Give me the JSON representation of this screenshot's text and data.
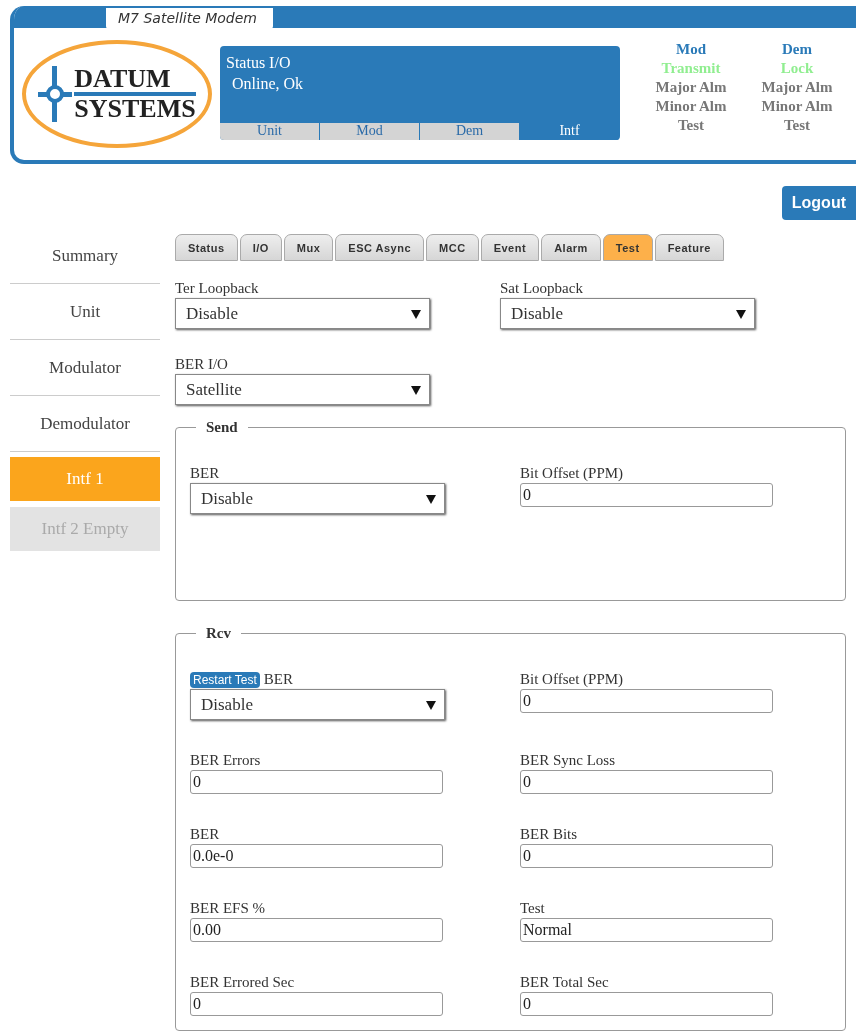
{
  "header": {
    "title": "M7 Satellite Modem",
    "logo": [
      "DATUM",
      "SYSTEMS"
    ],
    "status": {
      "label": "Status I/O",
      "value": "Online, Ok",
      "tabs": [
        {
          "label": "Unit",
          "selected": false
        },
        {
          "label": "Mod",
          "selected": false
        },
        {
          "label": "Dem",
          "selected": false
        },
        {
          "label": "Intf",
          "selected": true
        }
      ]
    },
    "indicators": [
      {
        "title": "Mod",
        "items": [
          {
            "label": "Transmit",
            "on": true
          },
          {
            "label": "Major Alm",
            "on": false
          },
          {
            "label": "Minor Alm",
            "on": false
          },
          {
            "label": "Test",
            "on": false
          }
        ]
      },
      {
        "title": "Dem",
        "items": [
          {
            "label": "Lock",
            "on": true
          },
          {
            "label": "Major Alm",
            "on": false
          },
          {
            "label": "Minor Alm",
            "on": false
          },
          {
            "label": "Test",
            "on": false
          }
        ]
      }
    ]
  },
  "logout": "Logout",
  "sidebar": {
    "items": [
      {
        "label": "Summary",
        "selected": false,
        "disabled": false
      },
      {
        "label": "Unit",
        "selected": false,
        "disabled": false
      },
      {
        "label": "Modulator",
        "selected": false,
        "disabled": false
      },
      {
        "label": "Demodulator",
        "selected": false,
        "disabled": false
      },
      {
        "label": "Intf 1",
        "selected": true,
        "disabled": false
      },
      {
        "label": "Intf 2 Empty",
        "selected": false,
        "disabled": true
      }
    ]
  },
  "tabs": [
    {
      "label": "Status",
      "selected": false
    },
    {
      "label": "I/O",
      "selected": false
    },
    {
      "label": "Mux",
      "selected": false
    },
    {
      "label": "ESC Async",
      "selected": false
    },
    {
      "label": "MCC",
      "selected": false
    },
    {
      "label": "Event",
      "selected": false
    },
    {
      "label": "Alarm",
      "selected": false
    },
    {
      "label": "Test",
      "selected": true
    },
    {
      "label": "Feature",
      "selected": false
    }
  ],
  "fields": [
    {
      "label": "Ter Loopback",
      "kind": "select",
      "value": "Disable"
    },
    {
      "label": "Sat Loopback",
      "kind": "select",
      "value": "Disable"
    },
    {
      "label": "BER I/O",
      "kind": "select",
      "value": "Satellite"
    }
  ],
  "sections": [
    {
      "legend": "Send",
      "fields": [
        {
          "label": "BER",
          "kind": "select",
          "value": "Disable"
        },
        {
          "label": "Bit Offset (PPM)",
          "kind": "input",
          "value": "0"
        }
      ]
    },
    {
      "legend": "Rcv",
      "fields": [
        {
          "label": "BER",
          "kind": "select",
          "value": "Disable",
          "button": "Restart Test"
        },
        {
          "label": "Bit Offset (PPM)",
          "kind": "input",
          "value": "0"
        },
        {
          "label": "BER Errors",
          "kind": "input",
          "value": "0"
        },
        {
          "label": "BER Sync Loss",
          "kind": "input",
          "value": "0"
        },
        {
          "label": "BER",
          "kind": "input",
          "value": "0.0e-0"
        },
        {
          "label": "BER Bits",
          "kind": "input",
          "value": "0"
        },
        {
          "label": "BER EFS %",
          "kind": "input",
          "value": "0.00"
        },
        {
          "label": "Test",
          "kind": "input",
          "value": "Normal"
        },
        {
          "label": "BER Errored Sec",
          "kind": "input",
          "value": "0"
        },
        {
          "label": "BER Total Sec",
          "kind": "input",
          "value": "0"
        }
      ]
    }
  ]
}
